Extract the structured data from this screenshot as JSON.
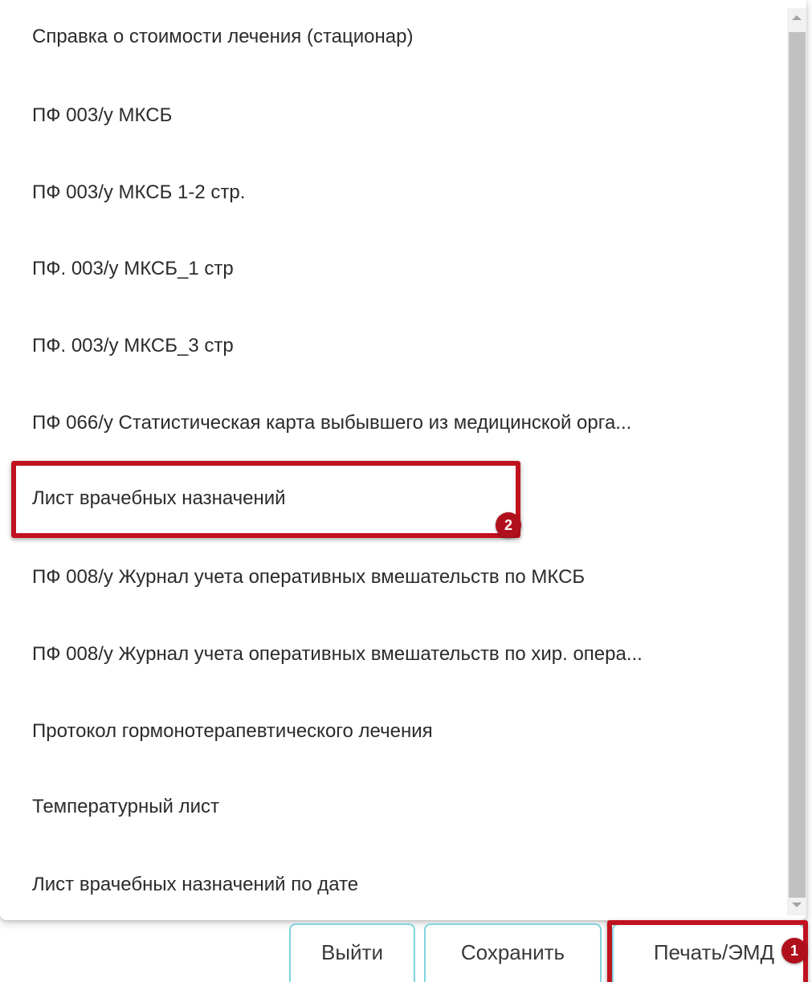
{
  "menu": {
    "items": [
      {
        "label": "Справка о стоимости лечения (стационар)"
      },
      {
        "label": "ПФ 003/у МКСБ"
      },
      {
        "label": "ПФ 003/у МКСБ 1-2 стр."
      },
      {
        "label": "ПФ. 003/у МКСБ_1 стр"
      },
      {
        "label": "ПФ. 003/у МКСБ_3 стр"
      },
      {
        "label": "ПФ 066/у Статистическая карта выбывшего из медицинской орга..."
      },
      {
        "label": "Лист врачебных назначений"
      },
      {
        "label": "ПФ 008/у Журнал учета оперативных вмешательств по МКСБ"
      },
      {
        "label": "ПФ 008/у Журнал учета оперативных вмешательств по хир. опера..."
      },
      {
        "label": "Протокол гормонотерапевтического лечения"
      },
      {
        "label": "Температурный лист"
      },
      {
        "label": "Лист врачебных назначений по дате"
      }
    ]
  },
  "buttons": {
    "exit_label": "Выйти",
    "save_label": "Сохранить",
    "print_label": "Печать/ЭМД"
  },
  "annotations": {
    "badge_1": "1",
    "badge_2": "2"
  },
  "colors": {
    "highlight": "#c1121f",
    "button_border": "#7fd3de"
  }
}
